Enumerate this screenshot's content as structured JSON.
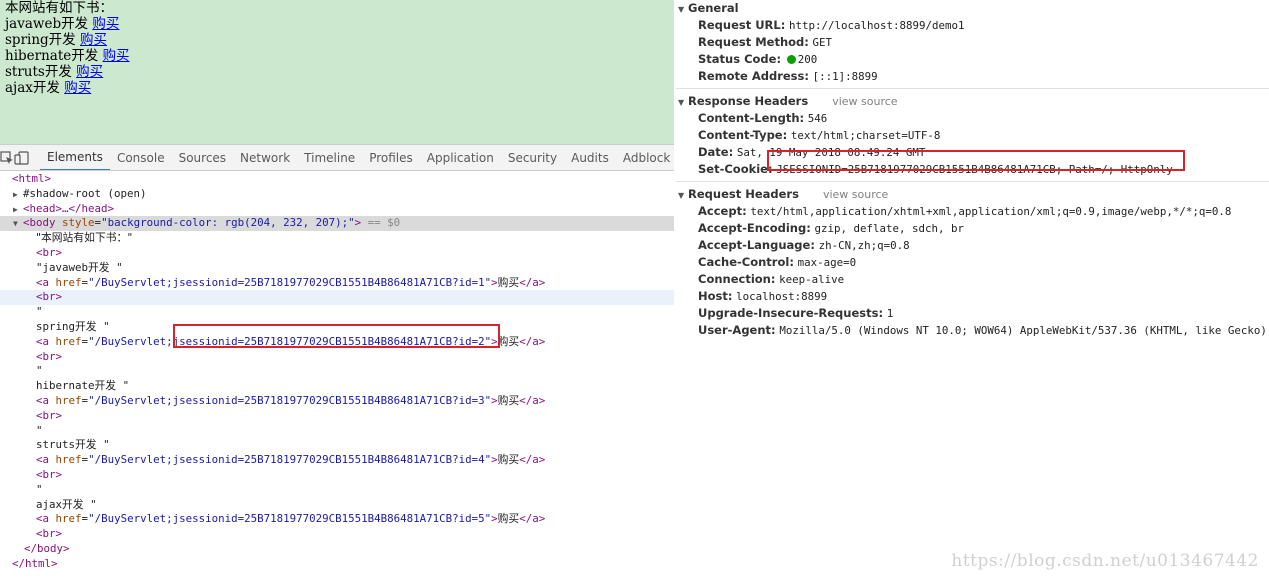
{
  "page": {
    "intro": "本网站有如下书：",
    "books": [
      {
        "name": "javaweb开发",
        "link": "购买"
      },
      {
        "name": "spring开发",
        "link": "购买"
      },
      {
        "name": "hibernate开发",
        "link": "购买"
      },
      {
        "name": "struts开发",
        "link": "购买"
      },
      {
        "name": "ajax开发",
        "link": "购买"
      }
    ]
  },
  "toolbar": {
    "tabs": [
      "Elements",
      "Console",
      "Sources",
      "Network",
      "Timeline",
      "Profiles",
      "Application",
      "Security",
      "Audits",
      "Adblock Pl"
    ],
    "active_tab": "Elements"
  },
  "elements": {
    "html_open": "<html>",
    "shadow_root": "#shadow-root (open)",
    "head": "<head>…</head>",
    "body_tag_open": "<body",
    "body_attr_name": "style",
    "body_attr_val": "\"background-color: rgb(204, 232, 207);\"",
    "body_tag_close": ">",
    "body_eq": "== $0",
    "intro_text": "\"本网站有如下书：\"",
    "br": "<br>",
    "quote": "\"",
    "a_open": "<a",
    "href_name": "href",
    "a_close_open": ">",
    "a_end": "</a>",
    "buy": "购买",
    "items": [
      {
        "text": "\"javaweb开发   \"",
        "href": "\"/BuyServlet;jsessionid=25B7181977029CB1551B4B86481A71CB?id=1\""
      },
      {
        "text": "spring开发   \"",
        "href": "\"/BuyServlet;jsessionid=25B7181977029CB1551B4B86481A71CB?id=2\""
      },
      {
        "text": "hibernate开发   \"",
        "href": "\"/BuyServlet;jsessionid=25B7181977029CB1551B4B86481A71CB?id=3\""
      },
      {
        "text": "struts开发   \"",
        "href": "\"/BuyServlet;jsessionid=25B7181977029CB1551B4B86481A71CB?id=4\""
      },
      {
        "text": "ajax开发   \"",
        "href": "\"/BuyServlet;jsessionid=25B7181977029CB1551B4B86481A71CB?id=5\""
      }
    ],
    "body_close": "</body>",
    "html_close": "</html>"
  },
  "headers": {
    "general": {
      "title": "General",
      "rows": [
        {
          "key": "Request URL:",
          "value": "http://localhost:8899/demo1"
        },
        {
          "key": "Request Method:",
          "value": "GET"
        },
        {
          "key": "Status Code:",
          "value": "200"
        },
        {
          "key": "Remote Address:",
          "value": "[::1]:8899"
        }
      ]
    },
    "response": {
      "title": "Response Headers",
      "view_source": "view source",
      "rows": [
        {
          "key": "Content-Length:",
          "value": "546"
        },
        {
          "key": "Content-Type:",
          "value": "text/html;charset=UTF-8"
        },
        {
          "key": "Date:",
          "value": "Sat, 19 May 2018 08:49:24 GMT"
        },
        {
          "key": "Set-Cookie:",
          "value": "JSESSIONID=25B7181977029CB1551B4B86481A71CB; Path=/; HttpOnly"
        }
      ]
    },
    "request": {
      "title": "Request Headers",
      "view_source": "view source",
      "rows": [
        {
          "key": "Accept:",
          "value": "text/html,application/xhtml+xml,application/xml;q=0.9,image/webp,*/*;q=0.8"
        },
        {
          "key": "Accept-Encoding:",
          "value": "gzip, deflate, sdch, br"
        },
        {
          "key": "Accept-Language:",
          "value": "zh-CN,zh;q=0.8"
        },
        {
          "key": "Cache-Control:",
          "value": "max-age=0"
        },
        {
          "key": "Connection:",
          "value": "keep-alive"
        },
        {
          "key": "Host:",
          "value": "localhost:8899"
        },
        {
          "key": "Upgrade-Insecure-Requests:",
          "value": "1"
        },
        {
          "key": "User-Agent:",
          "value": "Mozilla/5.0 (Windows NT 10.0; WOW64) AppleWebKit/537.36 (KHTML, like Gecko)"
        }
      ]
    }
  },
  "watermark": "https://blog.csdn.net/u013467442",
  "colors": {
    "page_bg": "#cce8cf",
    "highlight_box": "#d9232c",
    "status_ok": "#0a9e01",
    "active_tab": "#3879d9"
  }
}
